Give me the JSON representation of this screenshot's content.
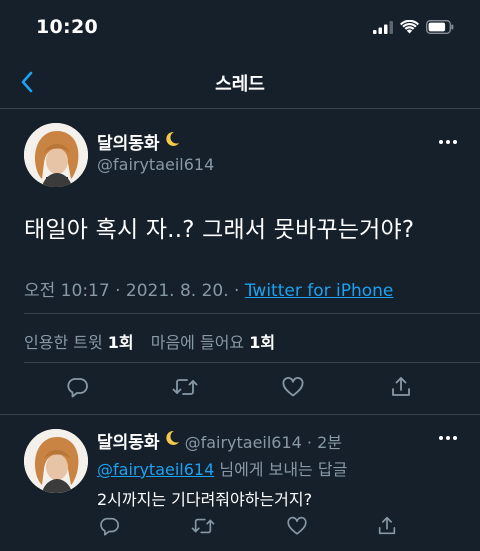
{
  "status_bar": {
    "time": "10:20"
  },
  "header": {
    "title": "스레드"
  },
  "tweet": {
    "author_name": "달의동화",
    "author_handle": "@fairytaeil614",
    "text": "태일아 혹시 자..? 그래서 못바꾸는거야?",
    "time": "오전 10:17 · 2021. 8. 20. · ",
    "source": "Twitter for iPhone",
    "stats": {
      "quote_label": "인용한 트윗 ",
      "quote_count": "1회",
      "like_label": "마음에 들어요 ",
      "like_count": "1회"
    }
  },
  "reply": {
    "author_name": "달의동화",
    "handle_time": "@fairytaeil614 · 2분",
    "mention": "@fairytaeil614",
    "replying_suffix": " 님에게 보내는 답글",
    "text": "2시까지는 기다려줘야하는거지?"
  },
  "colors": {
    "background": "#15202b",
    "accent": "#1da1f2",
    "secondary_text": "#8899a6",
    "divider": "#38444d"
  },
  "icons": [
    "back-arrow-icon",
    "more-icon",
    "reply-icon",
    "retweet-icon",
    "like-icon",
    "share-icon",
    "moon-icon",
    "signal-icon",
    "wifi-icon",
    "battery-icon"
  ]
}
